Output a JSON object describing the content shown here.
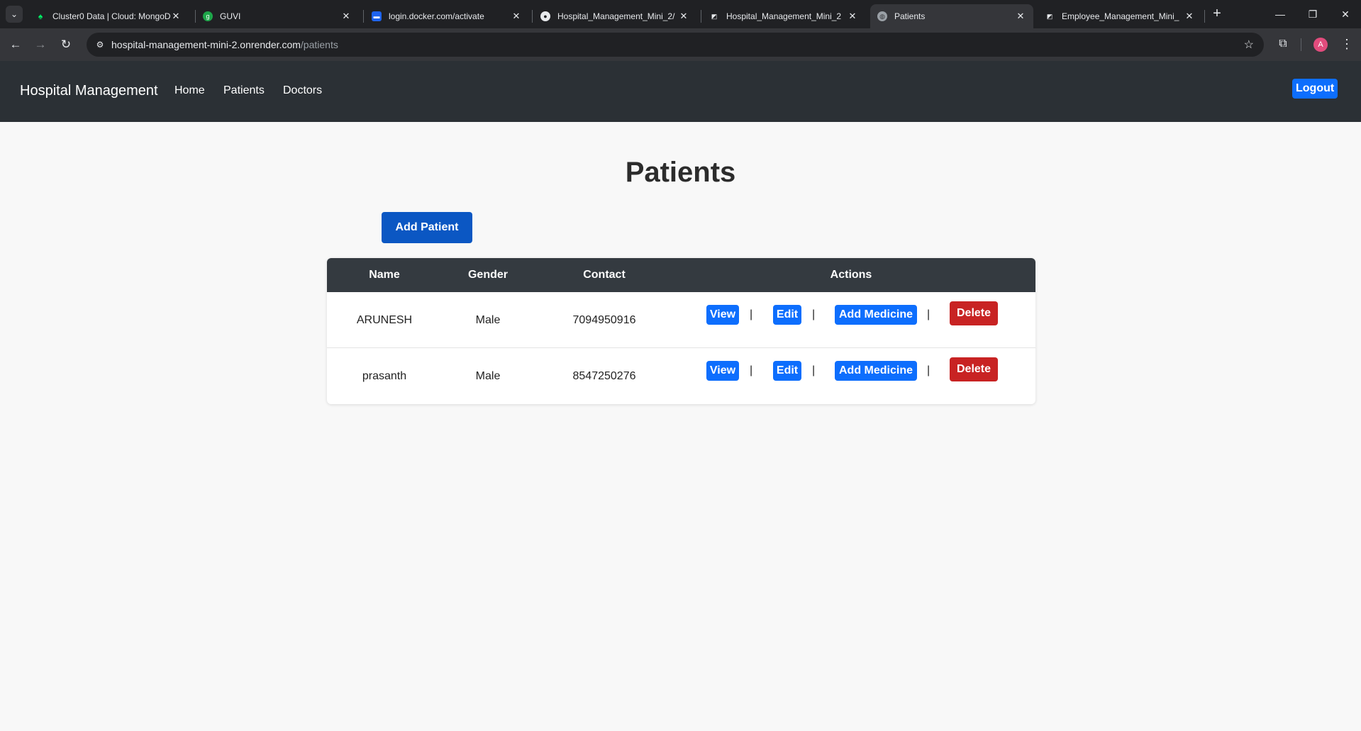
{
  "browser": {
    "tabs": [
      {
        "title": "Cluster0 Data | Cloud: MongoDB",
        "favicon": "mongodb-leaf-icon",
        "active": false
      },
      {
        "title": "GUVI",
        "favicon": "guvi-icon",
        "active": false
      },
      {
        "title": "login.docker.com/activate",
        "favicon": "docker-icon",
        "active": false
      },
      {
        "title": "Hospital_Management_Mini_2/",
        "favicon": "github-icon",
        "active": false
      },
      {
        "title": "Hospital_Management_Mini_2",
        "favicon": "render-icon",
        "active": false
      },
      {
        "title": "Patients",
        "favicon": "globe-icon",
        "active": true
      },
      {
        "title": "Employee_Management_Mini_",
        "favicon": "render-icon",
        "active": false
      }
    ],
    "url_host": "hospital-management-mini-2.onrender.com",
    "url_path": "/patients",
    "profile_initial": "A"
  },
  "app": {
    "brand": "Hospital Management",
    "nav": [
      "Home",
      "Patients",
      "Doctors"
    ],
    "logout_label": "Logout"
  },
  "page": {
    "title": "Patients",
    "add_button": "Add Patient"
  },
  "table": {
    "headers": {
      "name": "Name",
      "gender": "Gender",
      "contact": "Contact",
      "actions": "Actions"
    },
    "rows": [
      {
        "name": "ARUNESH",
        "gender": "Male",
        "contact": "7094950916"
      },
      {
        "name": "prasanth",
        "gender": "Male",
        "contact": "8547250276"
      }
    ],
    "actions": {
      "view": "View",
      "edit": "Edit",
      "add_medicine": "Add Medicine",
      "delete": "Delete",
      "separator": "|"
    }
  },
  "colors": {
    "primary": "#0d6efd",
    "danger": "#c82323",
    "header_bg": "#2b3035",
    "table_head": "#343a40"
  }
}
